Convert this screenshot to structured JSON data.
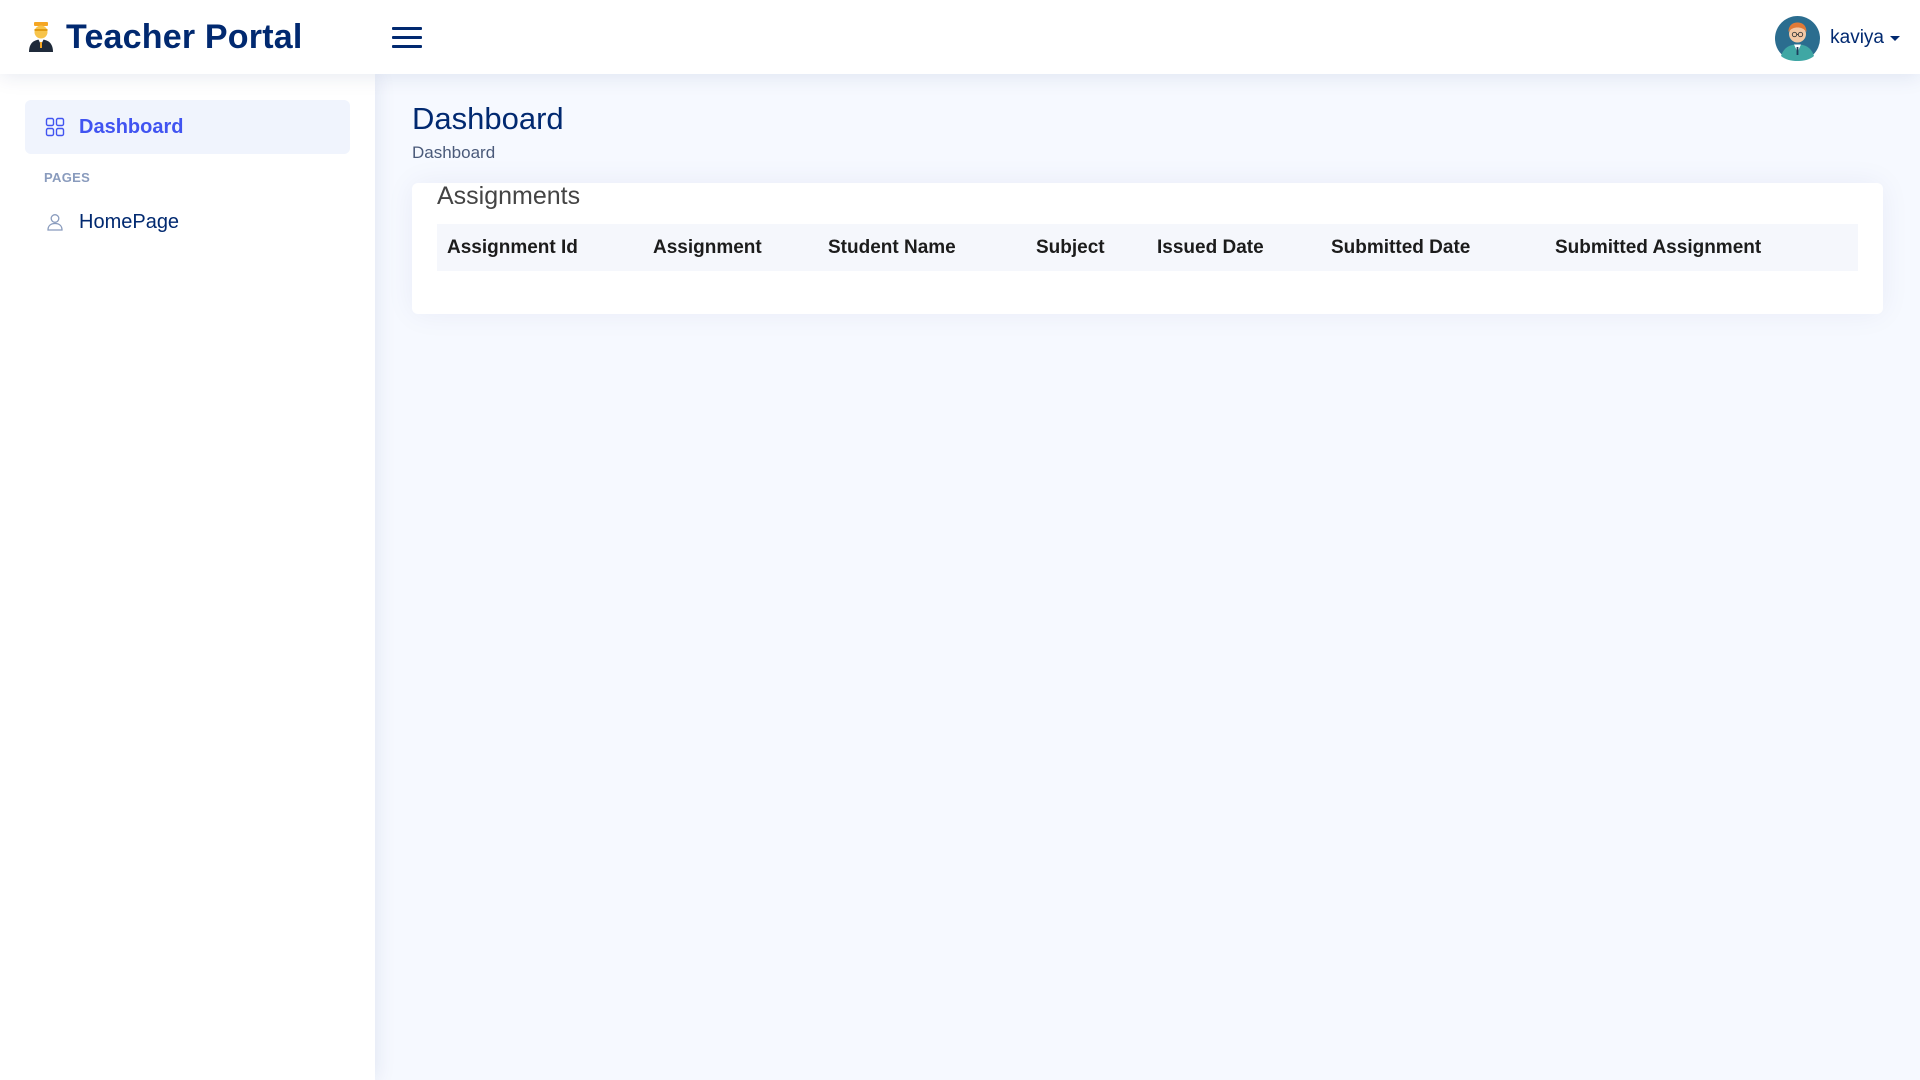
{
  "header": {
    "title": "Teacher Portal",
    "logo_icon": "teacher-icon",
    "menu_icon": "hamburger-icon",
    "user": {
      "name": "kaviya",
      "avatar_icon": "avatar-icon",
      "caret_icon": "caret-down-icon"
    }
  },
  "sidebar": {
    "items": [
      {
        "label": "Dashboard",
        "icon": "grid-icon",
        "active": true
      }
    ],
    "section_heading": "PAGES",
    "pages": [
      {
        "label": "HomePage",
        "icon": "person-icon"
      }
    ]
  },
  "main": {
    "page_title": "Dashboard",
    "breadcrumb": "Dashboard",
    "card": {
      "title": "Assignments",
      "table": {
        "columns": [
          "Assignment Id",
          "Assignment",
          "Student Name",
          "Subject",
          "Issued Date",
          "Submitted Date",
          "Submitted Assignment"
        ],
        "rows": []
      }
    }
  },
  "colors": {
    "brand": "#012970",
    "accent": "#4154f1",
    "background": "#f6f9ff",
    "active_bg": "#f0f4fd",
    "muted": "#899bbd"
  }
}
